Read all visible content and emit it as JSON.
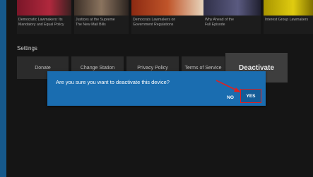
{
  "thumbnails": [
    {
      "caption": "Democratic Lawmakers: Its\nMandatory and Equal Policy",
      "color": "#8a1c2e"
    },
    {
      "caption": "Justices at the Supreme\nThe New Mail Bills",
      "color": "#6d5a4a"
    },
    {
      "caption": "Democrats Lawmakers on\nGovernment Regulations",
      "color": "#a33a1a"
    },
    {
      "caption": "Why Ahead of the\nFull Episode",
      "color": "#4a4a6a"
    },
    {
      "caption": "Interest Group Lawmakers",
      "color": "#c7b200"
    }
  ],
  "settings": {
    "title": "Settings",
    "tiles": [
      {
        "label": "Donate"
      },
      {
        "label": "Change Station"
      },
      {
        "label": "Privacy Policy"
      },
      {
        "label": "Terms of Service"
      },
      {
        "label": "Deactivate"
      }
    ]
  },
  "dialog": {
    "message": "Are you sure you want to deactivate this device?",
    "no_label": "NO",
    "yes_label": "YES"
  },
  "colors": {
    "dialog_bg": "#1a6db0",
    "highlight": "#e02020",
    "accent_edge": "#16598c"
  }
}
